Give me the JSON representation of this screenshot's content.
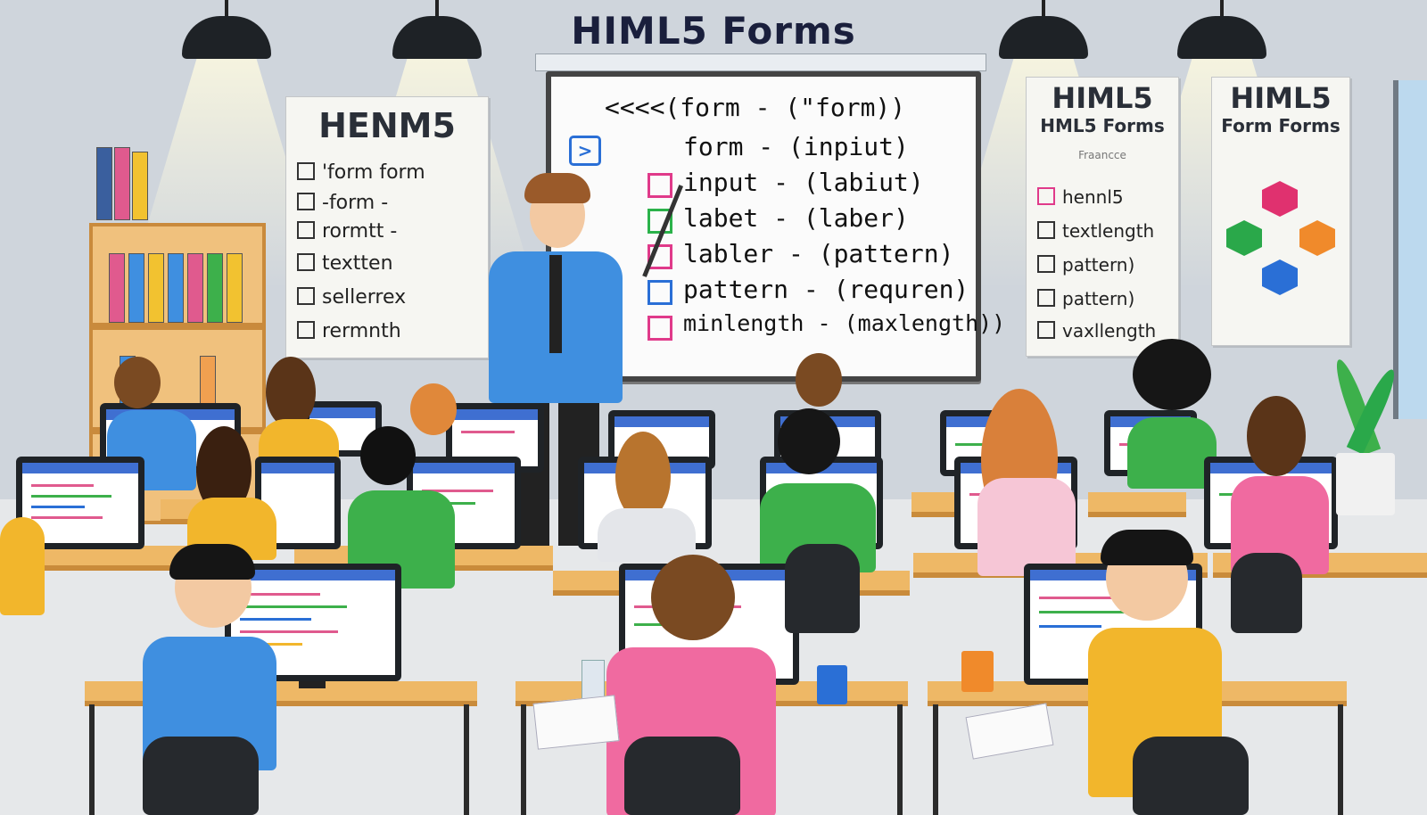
{
  "title": "HIML5 Forms",
  "whiteboard": {
    "lines": [
      "<<<<(form - (\"form))",
      "form - (inpiut)",
      "input - (labiut)",
      "labet - (laber)",
      "labler - (pattern)",
      "pattern - (requren)",
      "minlength - (maxlength))"
    ],
    "line_colors": [
      "#111111",
      "#111111",
      "#111111",
      "#111111",
      "#111111",
      "#111111",
      "#111111"
    ],
    "box_colors": [
      "#e03a8a",
      "#2bb24a",
      "#e03a8a",
      "#2a6fd6",
      "#e03a8a"
    ]
  },
  "poster_left": {
    "heading": "HENM5",
    "items": [
      "'form form",
      "-form -",
      "rormtt -",
      "textten",
      "sellerrex",
      "rermnth"
    ]
  },
  "poster_mid": {
    "heading": "HIML5",
    "subheading": "HML5 Forms",
    "scribble": "Fraancce",
    "items": [
      "hennl5",
      "textlength",
      "pattern)",
      "pattern)",
      "vaxllength"
    ]
  },
  "poster_right": {
    "heading": "HIML5",
    "subheading": "Form Forms",
    "hex_colors": [
      "#e0316f",
      "#2aa84a",
      "#f08a2b",
      "#2a6fd6"
    ]
  },
  "colors": {
    "wall": "#cfd5dc",
    "desk": "#eeb866",
    "shirt_blue": "#3f8fe0",
    "shirt_green": "#3db04b",
    "shirt_pink": "#f06aa0",
    "shirt_yellow": "#f2b62c"
  }
}
